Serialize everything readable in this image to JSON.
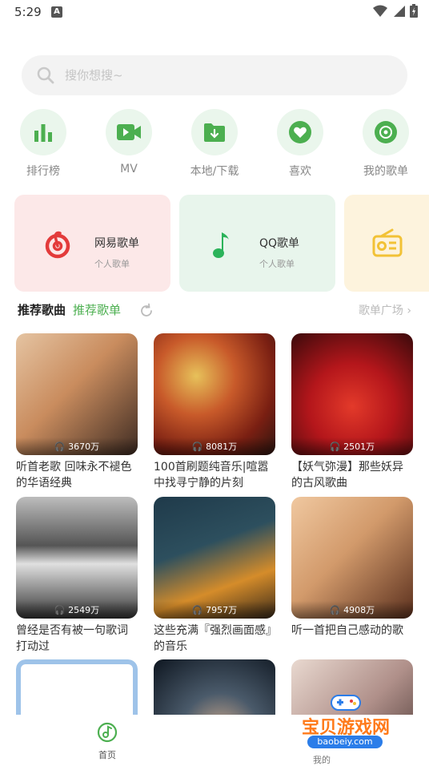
{
  "status_bar": {
    "time": "5:29",
    "a_badge": "A"
  },
  "search": {
    "placeholder": "搜你想搜~",
    "icon": "search-icon"
  },
  "quick_nav": [
    {
      "label": "排行榜",
      "icon": "bar-chart-icon"
    },
    {
      "label": "MV",
      "icon": "video-icon"
    },
    {
      "label": "本地/下载",
      "icon": "folder-download-icon"
    },
    {
      "label": "喜欢",
      "icon": "heart-icon"
    },
    {
      "label": "我的歌单",
      "icon": "disc-icon"
    }
  ],
  "cards": [
    {
      "title": "网易歌单",
      "subtitle": "个人歌单",
      "icon": "netease-icon",
      "bg": "#fce8e8"
    },
    {
      "title": "QQ歌单",
      "subtitle": "个人歌单",
      "icon": "qq-music-note-icon",
      "bg": "#e8f5ec"
    },
    {
      "title": "",
      "subtitle": "",
      "icon": "radio-icon",
      "bg": "#fdf3dd"
    }
  ],
  "recommend": {
    "title": "推荐歌曲",
    "tab": "推荐歌单",
    "square_link": "歌单广场 ›"
  },
  "playlists": [
    {
      "title": "听首老歌 回味永不褪色的华语经典",
      "plays": "3670万",
      "palette": [
        "#d9a77c",
        "#3e2b22"
      ]
    },
    {
      "title": "100首刷题纯音乐|喧嚣中找寻宁静的片刻",
      "plays": "8081万",
      "palette": [
        "#b63a1f",
        "#e7c15a"
      ]
    },
    {
      "title": "【妖气弥漫】那些妖异的古风歌曲",
      "plays": "2501万",
      "palette": [
        "#b4161b",
        "#3a0a0b"
      ]
    },
    {
      "title": "曾经是否有被一句歌词打动过",
      "plays": "2549万",
      "palette": [
        "#d8d8d8",
        "#333333"
      ]
    },
    {
      "title": "这些充满『强烈画面感』的音乐",
      "plays": "7957万",
      "palette": [
        "#1f3a4a",
        "#d58c2a"
      ]
    },
    {
      "title": "听一首把自己感动的歌",
      "plays": "4908万",
      "palette": [
        "#d29a6b",
        "#5a2f1d"
      ]
    },
    {
      "title": "",
      "plays": "",
      "palette": [
        "#dfeaf5",
        "#9ec3e9"
      ]
    },
    {
      "title": "",
      "plays": "",
      "palette": [
        "#2c3b4c",
        "#0e1620"
      ]
    },
    {
      "title": "",
      "plays": "",
      "palette": [
        "#e9d9d0",
        "#3e2d2a"
      ]
    }
  ],
  "tab_bar": {
    "home": "首页",
    "mine": "我的"
  },
  "watermark": {
    "text": "宝贝游戏网",
    "sub": "baobeiy.com"
  },
  "colors": {
    "accent": "#4caf50",
    "icon_bg": "#eaf6ec"
  }
}
